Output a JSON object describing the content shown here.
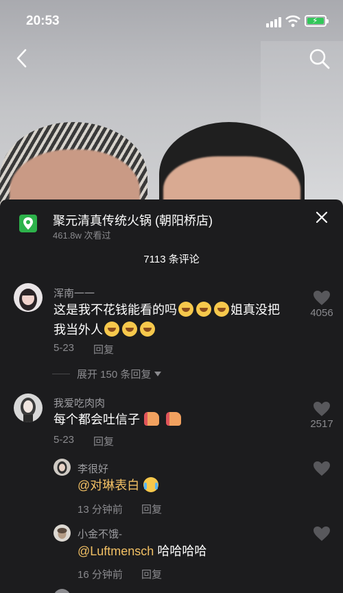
{
  "status_bar": {
    "time": "20:53"
  },
  "location": {
    "title": "聚元清真传统火锅 (朝阳桥店)",
    "views": "461.8w 次看过"
  },
  "comments_header": {
    "count_label": "7113 条评论"
  },
  "comments": [
    {
      "author": "浑南一一",
      "text_line1": "这是我不花钱能看的吗",
      "text_line1_suffix": "姐真没把",
      "text_line2": "我当外人",
      "date": "5-23",
      "reply_label": "回复",
      "likes": "4056",
      "expand_label": "展开 150 条回复"
    },
    {
      "author": "我爱吃肉肉",
      "text": "每个都会吐信子",
      "date": "5-23",
      "reply_label": "回复",
      "likes": "2517"
    }
  ],
  "replies": [
    {
      "author": "李很好",
      "mention": "@对琳表白",
      "text": "",
      "time": "13 分钟前",
      "reply_label": "回复"
    },
    {
      "author": "小金不饿-",
      "mention": "@Luftmensch",
      "text": " 哈哈哈哈",
      "time": "16 分钟前",
      "reply_label": "回复"
    }
  ],
  "icons": {
    "back": "chevron-left-icon",
    "search": "search-icon",
    "close": "close-icon",
    "location": "location-pin-icon",
    "like": "heart-icon"
  },
  "colors": {
    "sheet_bg": "#1c1c1e",
    "mention": "#f2c064",
    "location_badge": "#2db24b",
    "battery": "#32c759"
  }
}
